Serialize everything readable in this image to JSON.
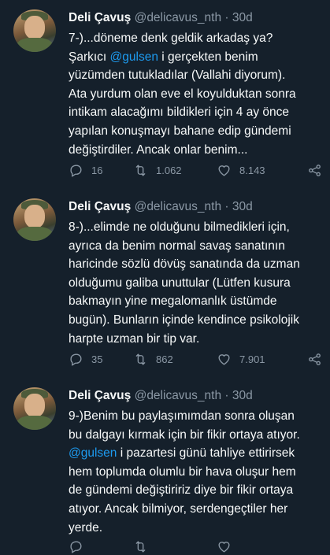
{
  "tweets": [
    {
      "name": "Deli Çavuş",
      "handle": "@delicavus_nth",
      "dot": "·",
      "time": "30d",
      "lines": [
        "7-)...döneme denk geldik arkadaş ya?",
        "Şarkıcı |@gulsen| i gerçekten benim",
        "yüzümden tutukladılar (Vallahi diyorum).",
        "Ata yurdum olan eve el koyulduktan sonra",
        "intikam alacağımı bildikleri için 4 ay önce",
        "yapılan konuşmayı bahane edip gündemi",
        "değiştirdiler. Ancak onlar benim..."
      ],
      "replies": "16",
      "retweets": "1.062",
      "likes": "8.143"
    },
    {
      "name": "Deli Çavuş",
      "handle": "@delicavus_nth",
      "dot": "·",
      "time": "30d",
      "lines": [
        "8-)...elimde ne olduğunu bilmedikleri için,",
        "ayrıca da benim normal savaş sanatının",
        "haricinde sözlü dövüş sanatında da uzman",
        "olduğumu galiba unuttular (Lütfen kusura",
        "bakmayın yine megalomanlık üstümde",
        "bugün). Bunların içinde kendince psikolojik",
        "harpte uzman bir tip var."
      ],
      "replies": "35",
      "retweets": "862",
      "likes": "7.901"
    },
    {
      "name": "Deli Çavuş",
      "handle": "@delicavus_nth",
      "dot": "·",
      "time": "30d",
      "lines": [
        "9-)Benim bu paylaşımımdan sonra oluşan",
        "bu dalgayı kırmak için bir fikir ortaya atıyor.",
        "|@gulsen| i pazartesi günü tahliye ettirirsek",
        "hem toplumda olumlu bir hava oluşur hem",
        "de gündemi değiştiririz diye bir fikir ortaya",
        "atıyor. Ancak bilmiyor, serdengeçtiler her",
        "yerde."
      ],
      "replies": "",
      "retweets": "",
      "likes": ""
    }
  ]
}
